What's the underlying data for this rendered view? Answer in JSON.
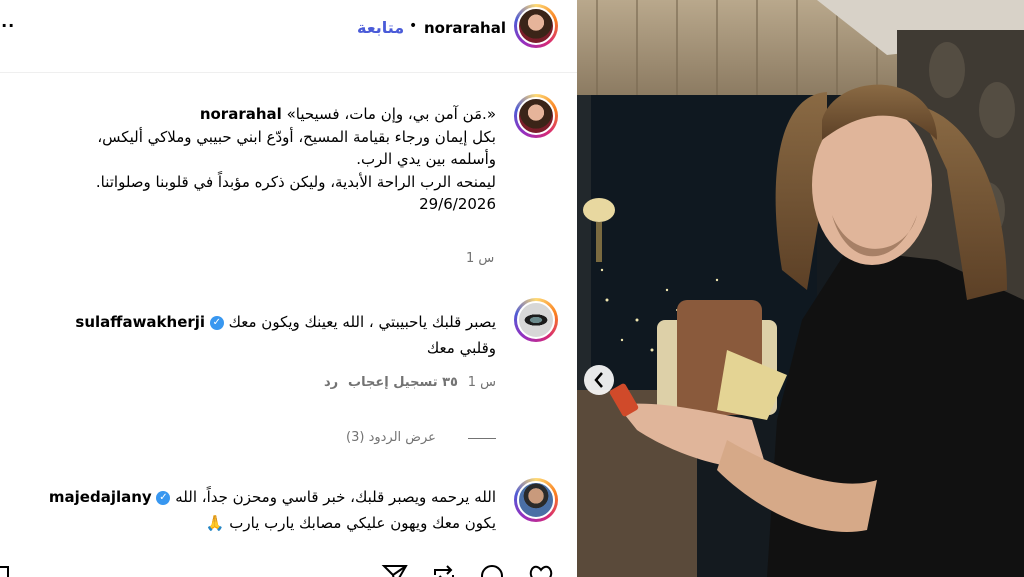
{
  "header": {
    "username": "norarahal",
    "follow_label": "متابعة",
    "bullet": "•",
    "more_label": "..."
  },
  "caption": {
    "username": "norarahal",
    "lines": [
      "«مَن آمن بي، وإن مات، فسيحيا.»",
      "بكل إيمان ورجاء بقيامة المسيح، أودّع ابني حبيبي وملاكي أليكس،",
      "وأسلمه بين يدي الرب.",
      "ليمنحه الرب الراحة الأبدية، وليكن ذكره مؤبداً في قلوبنا وصلواتنا.",
      "29/6/2026"
    ],
    "time": "1 س"
  },
  "comments": [
    {
      "username": "sulaffawakherji",
      "text_line1": "يصبر قلبك ياحبيبتي ، الله يعينك ويكون معك",
      "text_line2": "وقلبي معك",
      "time": "1 س",
      "likes": "٣٥ تسجيل إعجاب",
      "reply": "رد",
      "view_replies": "عرض الردود (3)"
    },
    {
      "username": "majedajlany",
      "text_line1": "الله يرحمه ويصبر قلبك، خبر قاسي ومحزن جداً، الله",
      "text_line2": "يكون معك ويهون عليكي مصابك يارب يارب 🙏"
    }
  ],
  "colors": {
    "follow": "#4a5bd8",
    "verified": "#3897f0",
    "muted": "#737373"
  }
}
